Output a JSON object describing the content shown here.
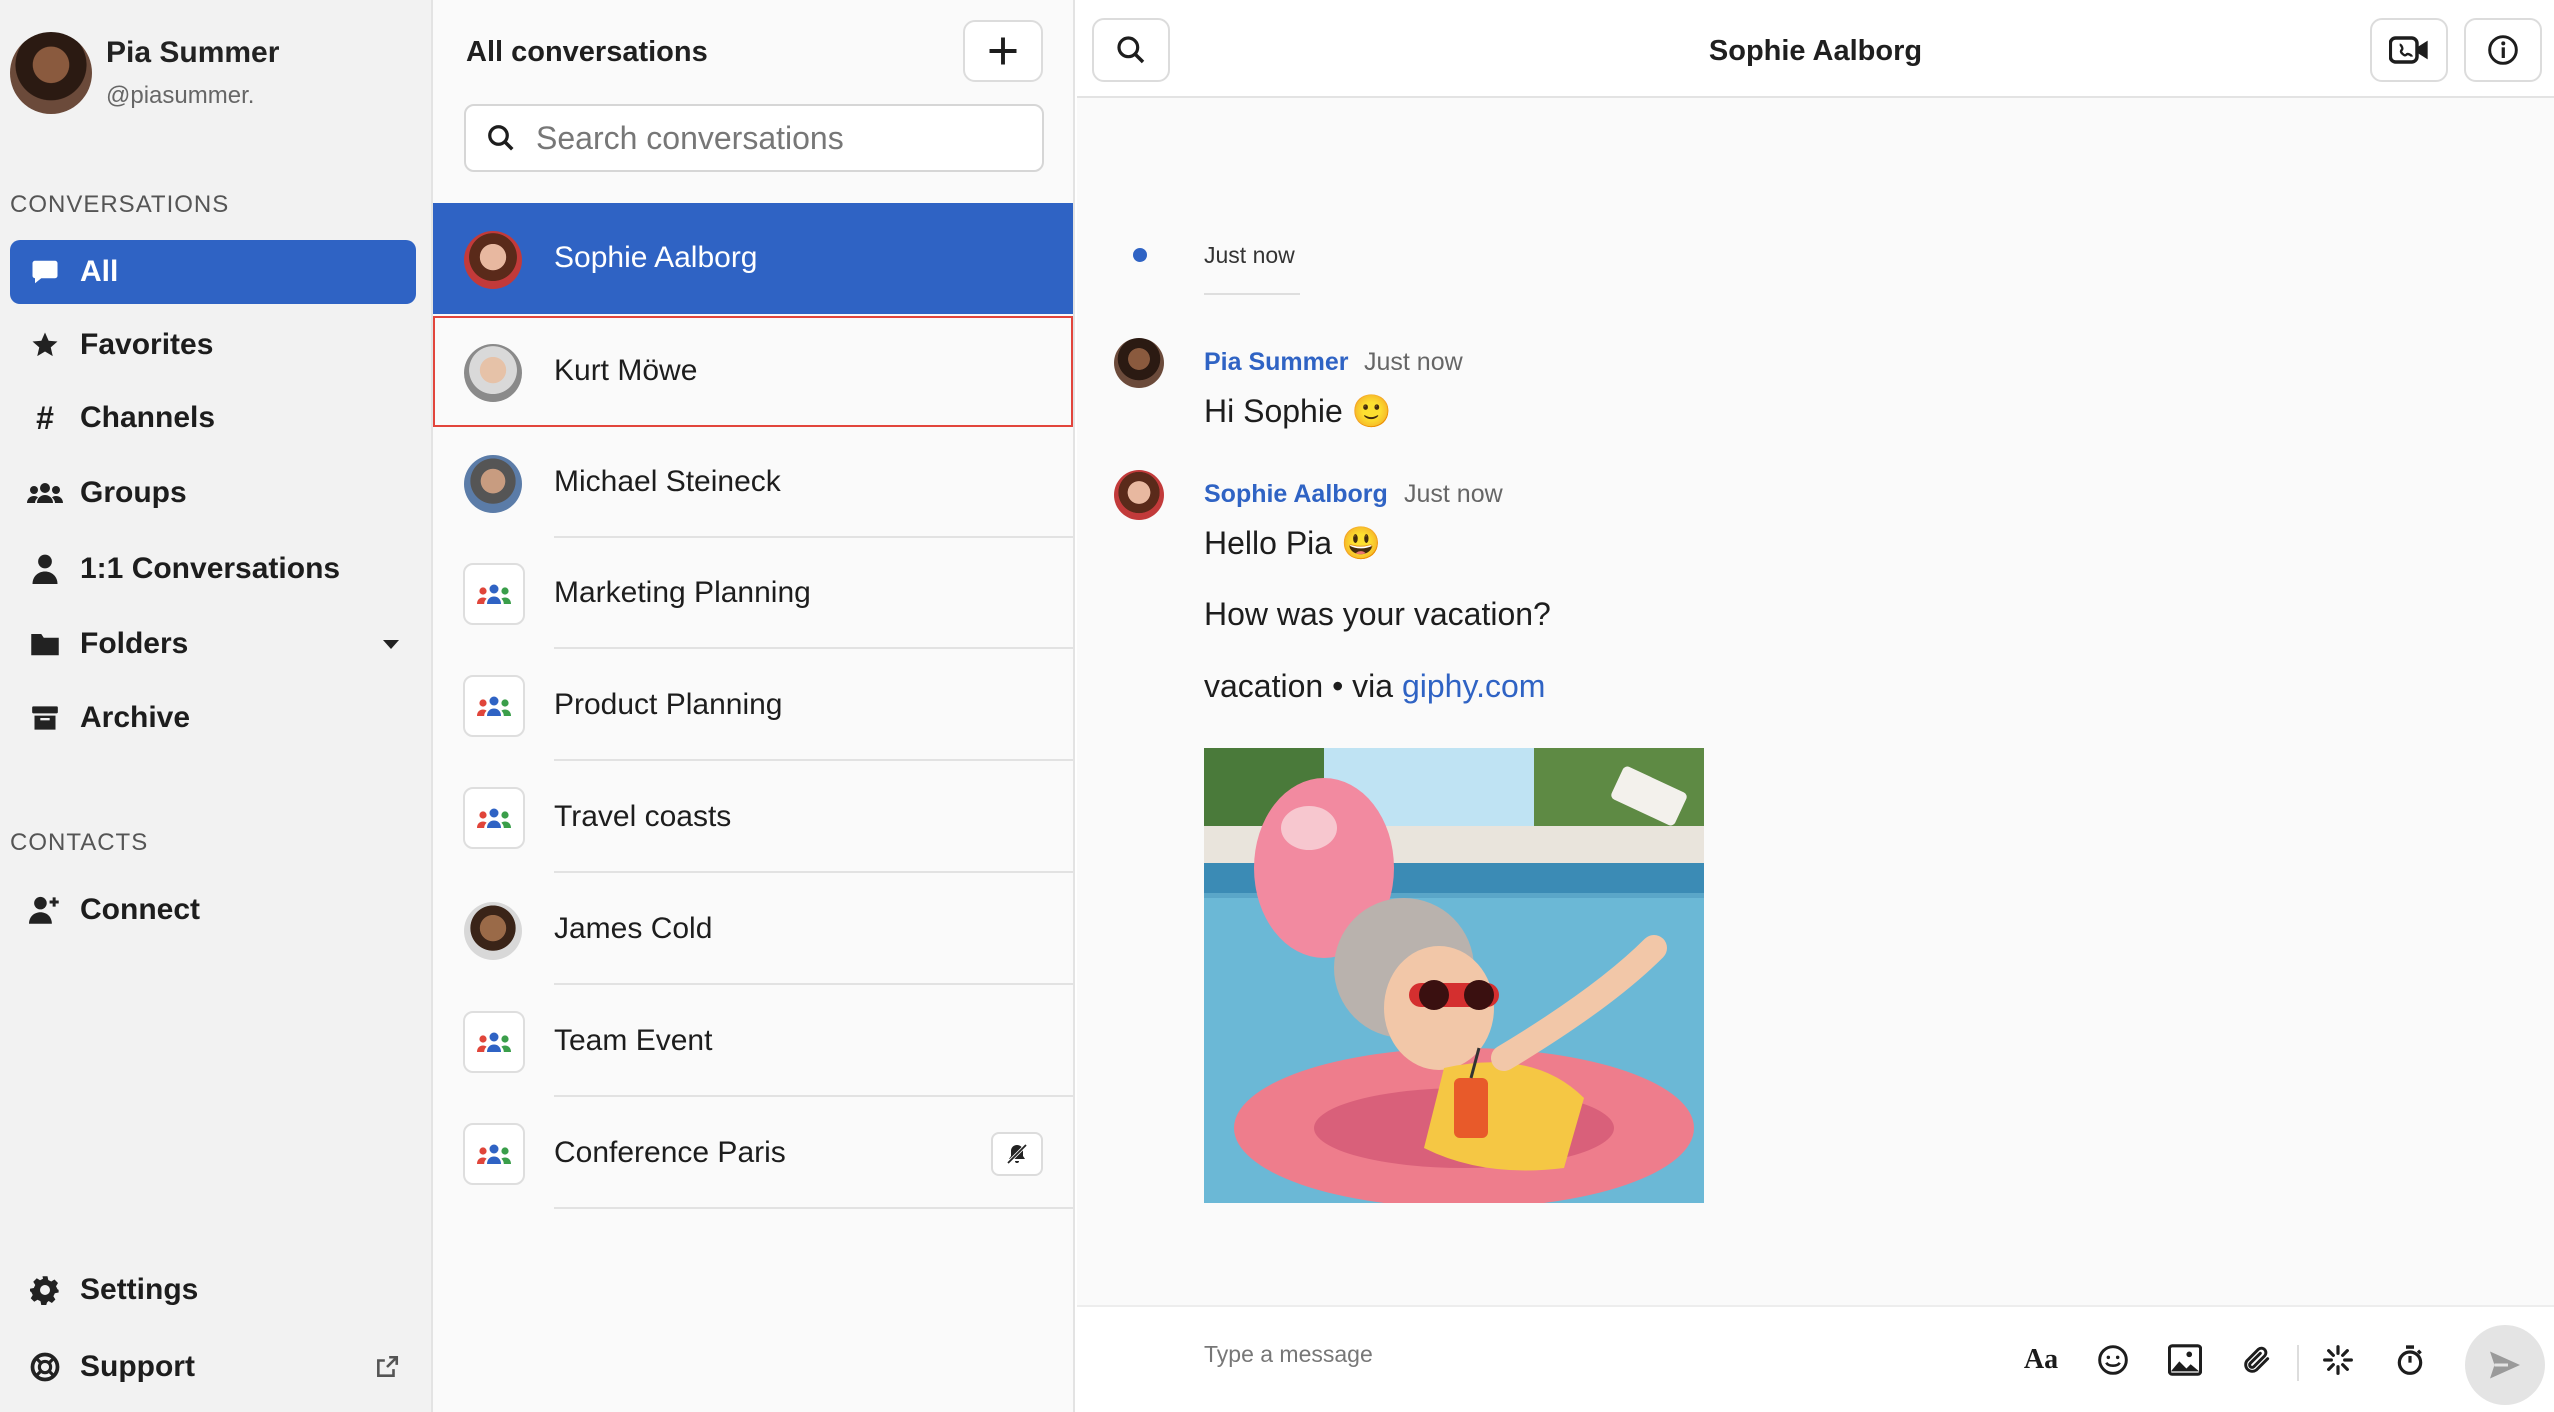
{
  "user": {
    "name": "Pia Summer",
    "handle": "@piasummer."
  },
  "sidebar": {
    "conversations_label": "CONVERSATIONS",
    "contacts_label": "CONTACTS",
    "items": [
      {
        "label": "All",
        "icon": "chat-bubble-icon",
        "active": true
      },
      {
        "label": "Favorites",
        "icon": "star-icon"
      },
      {
        "label": "Channels",
        "icon": "hashtag-icon"
      },
      {
        "label": "Groups",
        "icon": "users-icon"
      },
      {
        "label": "1:1 Conversations",
        "icon": "user-icon"
      },
      {
        "label": "Folders",
        "icon": "folder-icon"
      },
      {
        "label": "Archive",
        "icon": "archive-icon"
      }
    ],
    "contacts": [
      {
        "label": "Connect",
        "icon": "user-plus-icon"
      }
    ],
    "bottom": [
      {
        "label": "Settings",
        "icon": "gear-icon"
      },
      {
        "label": "Support",
        "icon": "lifebuoy-icon"
      }
    ]
  },
  "conversation_list": {
    "title": "All conversations",
    "search_placeholder": "Search conversations",
    "items": [
      {
        "name": "Sophie Aalborg",
        "type": "person"
      },
      {
        "name": "Kurt Möwe",
        "type": "person"
      },
      {
        "name": "Michael Steineck",
        "type": "person"
      },
      {
        "name": "Marketing Planning",
        "type": "group"
      },
      {
        "name": "Product Planning",
        "type": "group"
      },
      {
        "name": "Travel coasts",
        "type": "group"
      },
      {
        "name": "James Cold",
        "type": "person"
      },
      {
        "name": "Team Event",
        "type": "group"
      },
      {
        "name": "Conference Paris",
        "type": "group",
        "muted": true
      }
    ]
  },
  "chat": {
    "title": "Sophie Aalborg",
    "system_time": "Just now",
    "messages": [
      {
        "sender": "Pia Summer",
        "time": "Just now",
        "lines": [
          "Hi Sophie 🙂"
        ]
      },
      {
        "sender": "Sophie Aalborg",
        "time": "Just now",
        "lines": [
          "Hello Pia 😃",
          "How was your vacation?"
        ],
        "gif_caption_prefix": "vacation • via ",
        "gif_link": "giphy.com"
      }
    ],
    "composer_placeholder": "Type a message"
  },
  "colors": {
    "accent": "#2f63c4",
    "selected_outline": "#e2453c"
  }
}
